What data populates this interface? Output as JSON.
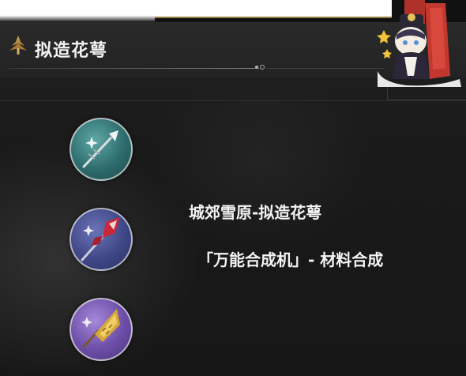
{
  "header": {
    "title": "拟造花萼",
    "title_icon": "pagoda-emblem-icon"
  },
  "materials": [
    {
      "name_icon": "silver-spear-icon",
      "rarity_color": "#2e6c6d"
    },
    {
      "name_icon": "crimson-spear-icon",
      "rarity_color": "#3f4787"
    },
    {
      "name_icon": "golden-spearhead-icon",
      "rarity_color": "#6c4ea8"
    }
  ],
  "sources": {
    "location": "城郊雪原-拟造花萼",
    "synthesis": "「万能合成机」- 材料合成"
  },
  "colors": {
    "accent_gold": "#9a7f45",
    "text_primary": "#f4f4f4",
    "background": "#1a1a1a"
  }
}
